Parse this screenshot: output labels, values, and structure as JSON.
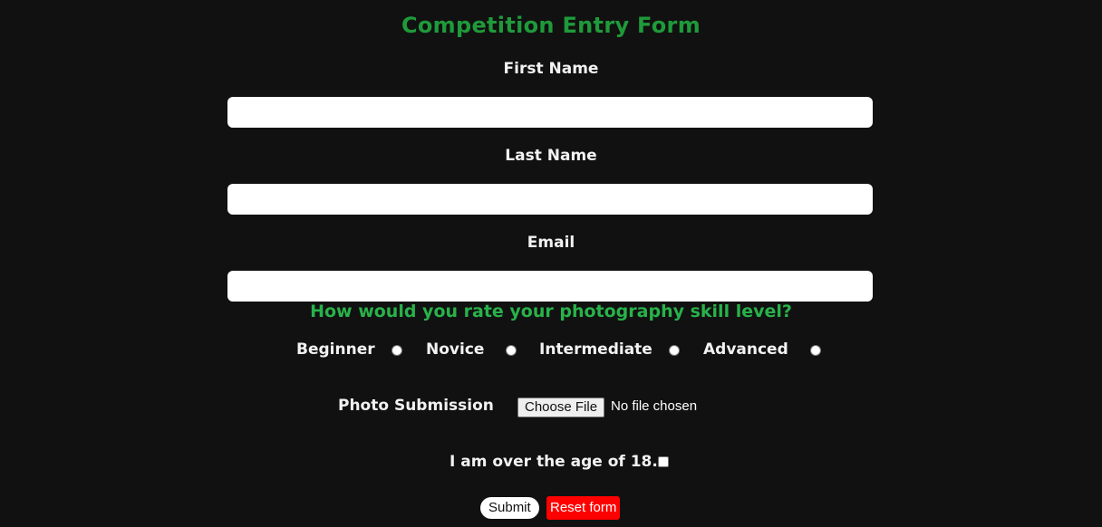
{
  "form": {
    "title": "Competition Entry Form",
    "fields": {
      "first_name": {
        "label": "First Name",
        "value": ""
      },
      "last_name": {
        "label": "Last Name",
        "value": ""
      },
      "email": {
        "label": "Email",
        "value": ""
      }
    },
    "skill": {
      "question": "How would you rate your photography skill level?",
      "options": [
        "Beginner",
        "Novice",
        "Intermediate",
        "Advanced"
      ],
      "selected": null
    },
    "photo": {
      "label": "Photo Submission",
      "button": "Choose File",
      "status": "No file chosen"
    },
    "age": {
      "label": "I am over the age of 18.",
      "checked": false
    },
    "buttons": {
      "submit": "Submit",
      "reset": "Reset form"
    }
  },
  "colors": {
    "background": "#111111",
    "title": "#1f9a3a",
    "question": "#28b24a",
    "reset_button": "#ff0000"
  }
}
